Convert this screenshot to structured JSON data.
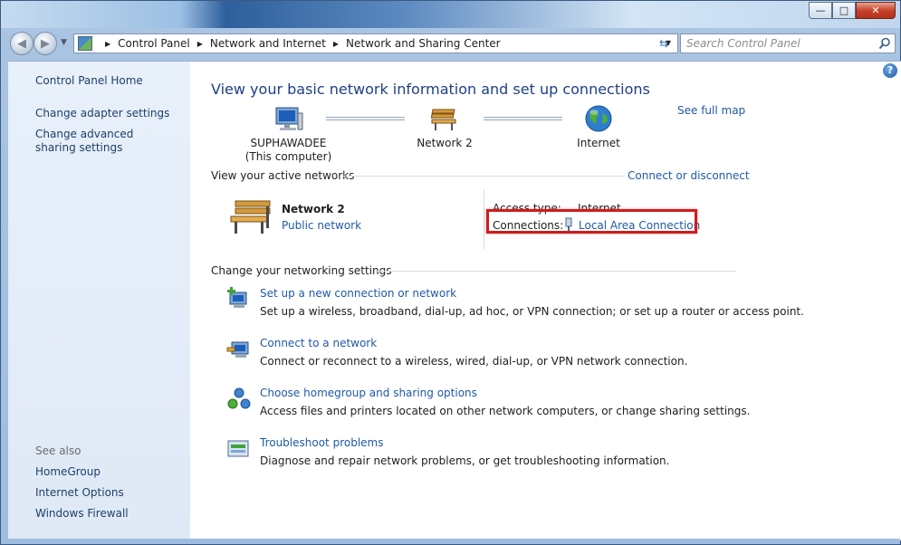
{
  "window": {
    "caption_min": "—",
    "caption_max": "□",
    "caption_close": "✕"
  },
  "nav": {
    "back_icon": "◀",
    "forward_icon": "▶",
    "breadcrumbs": [
      "Control Panel",
      "Network and Internet",
      "Network and Sharing Center"
    ],
    "search_placeholder": "Search Control Panel"
  },
  "sidebar": {
    "home": "Control Panel Home",
    "links": [
      "Change adapter settings",
      "Change advanced sharing settings"
    ],
    "see_also_heading": "See also",
    "see_also": [
      "HomeGroup",
      "Internet Options",
      "Windows Firewall"
    ]
  },
  "main": {
    "title": "View your basic network information and set up connections",
    "see_full_map": "See full map",
    "map": {
      "computer_name": "SUPHAWADEE",
      "computer_sub": "(This computer)",
      "network": "Network  2",
      "internet": "Internet"
    },
    "active_networks": {
      "heading": "View your active networks",
      "connect_link": "Connect or disconnect",
      "network_name": "Network  2",
      "network_type": "Public network",
      "access_type_label": "Access type:",
      "access_type_value": "Internet",
      "connections_label": "Connections:",
      "connections_value": "Local Area Connection"
    },
    "change_settings": {
      "heading": "Change your networking settings",
      "tasks": [
        {
          "title": "Set up a new connection or network",
          "desc": "Set up a wireless, broadband, dial-up, ad hoc, or VPN connection; or set up a router or access point."
        },
        {
          "title": "Connect to a network",
          "desc": "Connect or reconnect to a wireless, wired, dial-up, or VPN network connection."
        },
        {
          "title": "Choose homegroup and sharing options",
          "desc": "Access files and printers located on other network computers, or change sharing settings."
        },
        {
          "title": "Troubleshoot problems",
          "desc": "Diagnose and repair network problems, or get troubleshooting information."
        }
      ]
    }
  },
  "colors": {
    "link": "#1e5aa7",
    "title": "#1e3f87",
    "highlight": "#d01c1c"
  }
}
